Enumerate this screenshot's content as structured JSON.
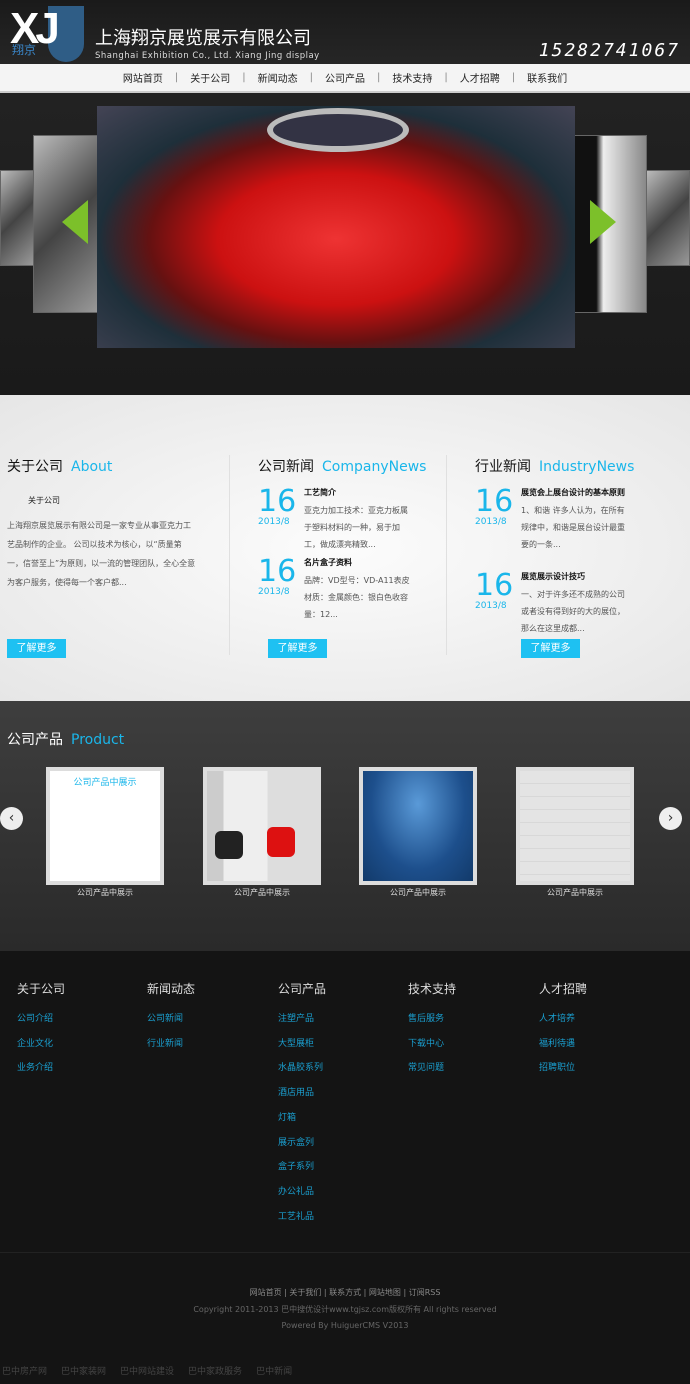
{
  "header": {
    "logo_letters": "XJ",
    "logo_cn": "翔京",
    "company_cn": "上海翔京展览展示有限公司",
    "company_en": "Shanghai Exhibition Co., Ltd. Xiang Jing display",
    "phone": "15282741067"
  },
  "nav": [
    "网站首页",
    "关于公司",
    "新闻动态",
    "公司产品",
    "技术支持",
    "人才招聘",
    "联系我们"
  ],
  "about": {
    "title": "关于公司",
    "title_en": "About",
    "subtitle": "关于公司",
    "text": "上海翔京展览展示有限公司是一家专业从事亚克力工艺品制作的企业。 公司以技术为核心，以“质量第一，信誉至上”为原则，以一流的管理团队，全心全意为客户服务，使得每一个客户都...",
    "more": "了解更多"
  },
  "company_news": {
    "title": "公司新闻",
    "title_en": "CompanyNews",
    "items": [
      {
        "day": "16",
        "ym": "2013/8",
        "title": "工艺简介",
        "text": "亚克力加工技术：亚克力板属于塑料材料的一种，易于加工，做成漂亮精致..."
      },
      {
        "day": "16",
        "ym": "2013/8",
        "title": "名片盒子资料",
        "text": "品牌：VD型号：VD-A11表皮材质：金属颜色：银白色收容量：12..."
      }
    ],
    "more": "了解更多"
  },
  "industry_news": {
    "title": "行业新闻",
    "title_en": "IndustryNews",
    "items": [
      {
        "day": "16",
        "ym": "2013/8",
        "title": "展览会上展台设计的基本原则",
        "text": "1、和谐 许多人认为，在所有规律中，和谐是展台设计最重要的一条..."
      },
      {
        "day": "16",
        "ym": "2013/8",
        "title": "展览展示设计技巧",
        "text": "一、对于许多还不成熟的公司或者没有得到好的大的展位，那么在这里成都..."
      }
    ],
    "more": "了解更多"
  },
  "product": {
    "title": "公司产品",
    "title_en": "Product",
    "placeholder_text": "公司产品中展示",
    "items": [
      "公司产品中展示",
      "公司产品中展示",
      "公司产品中展示",
      "公司产品中展示"
    ],
    "prev": "‹",
    "next": "›"
  },
  "footer": {
    "columns": [
      {
        "title": "关于公司",
        "links": [
          "公司介绍",
          "企业文化",
          "业务介绍"
        ]
      },
      {
        "title": "新闻动态",
        "links": [
          "公司新闻",
          "行业新闻"
        ]
      },
      {
        "title": "公司产品",
        "links": [
          "注塑产品",
          "大型展柜",
          "水晶胶系列",
          "酒店用品",
          "灯箱",
          "展示盒列",
          "盒子系列",
          "办公礼品",
          "工艺礼品"
        ]
      },
      {
        "title": "技术支持",
        "links": [
          "售后服务",
          "下载中心",
          "常见问题"
        ]
      },
      {
        "title": "人才招聘",
        "links": [
          "人才培养",
          "福利待遇",
          "招聘职位"
        ]
      }
    ],
    "bottom_links": "网站首页 | 关于我们 | 联系方式 | 网站地图 | 订阅RSS",
    "copyright": "Copyright 2011-2013 巴中搜优设计www.tgjsz.com版权所有 All rights reserved",
    "powered": "Powered By HuiguerCMS V2013",
    "friend_links": [
      "巴中房产网",
      "巴中家装网",
      "巴中网站建设",
      "巴中家政服务",
      "巴中新闻"
    ]
  },
  "colors": {
    "accent": "#1ab6ea",
    "button": "#1ec1f2",
    "footer_link": "#1a9fd0"
  }
}
